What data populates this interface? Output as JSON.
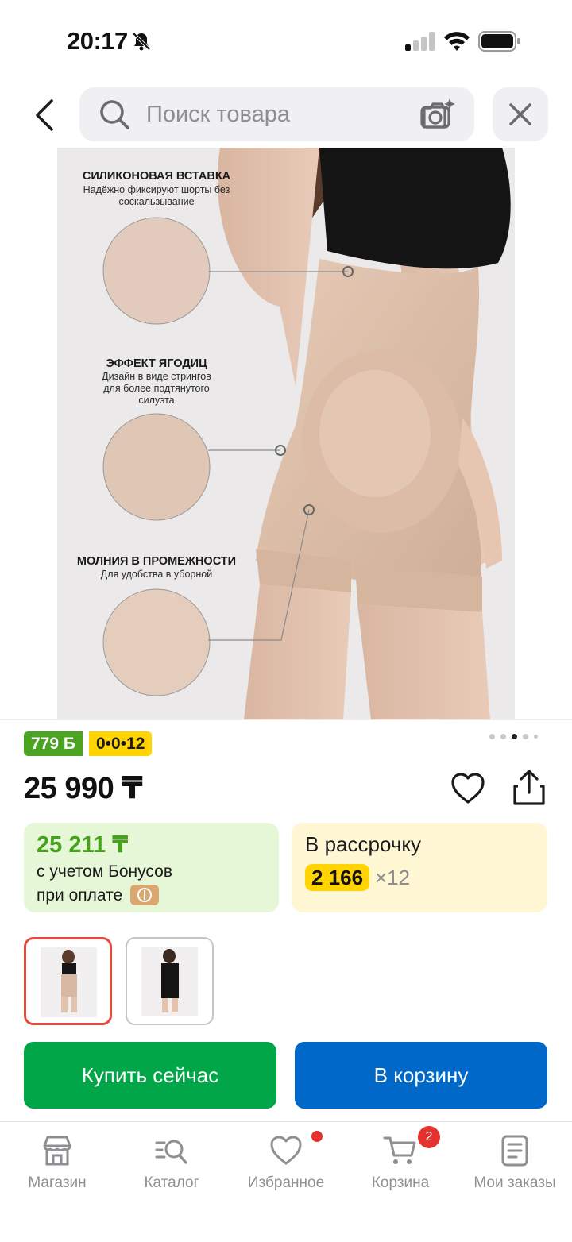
{
  "status_bar": {
    "time": "20:17"
  },
  "search": {
    "placeholder": "Поиск товара"
  },
  "product_image": {
    "features": [
      {
        "title": "СИЛИКОНОВАЯ ВСТАВКА",
        "desc": "Надёжно фиксируют шорты без соскальзывание"
      },
      {
        "title": "ЭФФЕКТ ЯГОДИЦ",
        "desc": "Дизайн в виде стрингов для более подтянутого силуэта"
      },
      {
        "title": "МОЛНИЯ В ПРОМЕЖНОСТИ",
        "desc": "Для удобства в уборной"
      }
    ],
    "gallery_position": {
      "active_index": 3,
      "count": 5
    }
  },
  "badges": {
    "bonus": "779 Б",
    "installment": "0•0•12"
  },
  "price": "25 990 ₸",
  "bonus_card": {
    "price": "25 211 ₸",
    "line1": "с учетом Бонусов",
    "line2": "при оплате"
  },
  "installment_card": {
    "title": "В рассрочку",
    "amount": "2 166",
    "times": "×12"
  },
  "variants": {
    "selected_index": 1,
    "count": 2
  },
  "actions": {
    "buy_now": "Купить сейчас",
    "add_to_cart": "В корзину"
  },
  "tabbar": {
    "items": [
      {
        "label": "Магазин",
        "icon": "store-icon"
      },
      {
        "label": "Каталог",
        "icon": "catalog-search-icon"
      },
      {
        "label": "Избранное",
        "icon": "heart-icon"
      },
      {
        "label": "Корзина",
        "icon": "cart-icon"
      },
      {
        "label": "Мои заказы",
        "icon": "orders-icon"
      }
    ],
    "cart_count": "2"
  },
  "colors": {
    "buy_button": "#00a648",
    "cart_button": "#0068c9",
    "bonus_badge": "#4aa421",
    "installment_badge": "#ffd400",
    "notification": "#e6322e"
  }
}
